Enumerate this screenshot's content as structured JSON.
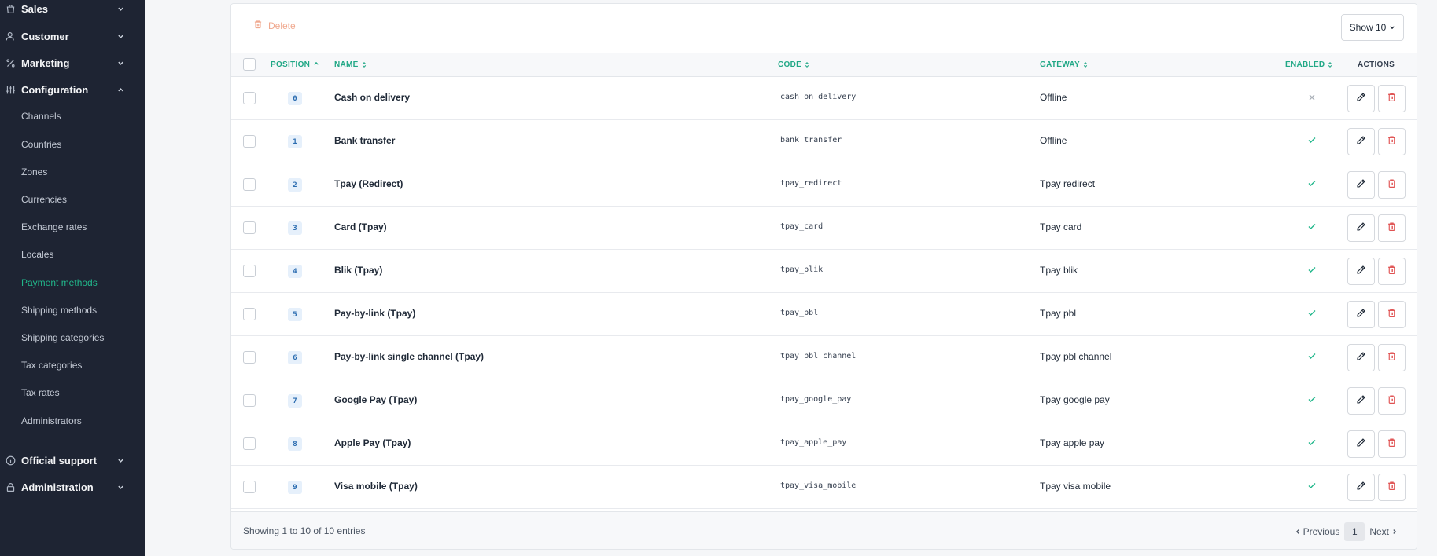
{
  "sidebar": {
    "groups": [
      {
        "label": "Sales",
        "icon": "shopping-bag-icon"
      },
      {
        "label": "Customer",
        "icon": "user-icon"
      },
      {
        "label": "Marketing",
        "icon": "percent-icon"
      },
      {
        "label": "Configuration",
        "icon": "sliders-icon"
      },
      {
        "label": "Official support",
        "icon": "info-icon"
      },
      {
        "label": "Administration",
        "icon": "lock-icon"
      }
    ],
    "config_items": [
      "Channels",
      "Countries",
      "Zones",
      "Currencies",
      "Exchange rates",
      "Locales",
      "Payment methods",
      "Shipping methods",
      "Shipping categories",
      "Tax categories",
      "Tax rates",
      "Administrators"
    ],
    "active_item": "Payment methods"
  },
  "toolbar": {
    "delete_label": "Delete",
    "show_label": "Show 10"
  },
  "table": {
    "headers": {
      "position": "POSITION",
      "name": "NAME",
      "code": "CODE",
      "gateway": "GATEWAY",
      "enabled": "ENABLED",
      "actions": "ACTIONS"
    },
    "rows": [
      {
        "position": "0",
        "name": "Cash on delivery",
        "code": "cash_on_delivery",
        "gateway": "Offline",
        "enabled": false
      },
      {
        "position": "1",
        "name": "Bank transfer",
        "code": "bank_transfer",
        "gateway": "Offline",
        "enabled": true
      },
      {
        "position": "2",
        "name": "Tpay (Redirect)",
        "code": "tpay_redirect",
        "gateway": "Tpay redirect",
        "enabled": true
      },
      {
        "position": "3",
        "name": "Card (Tpay)",
        "code": "tpay_card",
        "gateway": "Tpay card",
        "enabled": true
      },
      {
        "position": "4",
        "name": "Blik (Tpay)",
        "code": "tpay_blik",
        "gateway": "Tpay blik",
        "enabled": true
      },
      {
        "position": "5",
        "name": "Pay-by-link (Tpay)",
        "code": "tpay_pbl",
        "gateway": "Tpay pbl",
        "enabled": true
      },
      {
        "position": "6",
        "name": "Pay-by-link single channel (Tpay)",
        "code": "tpay_pbl_channel",
        "gateway": "Tpay pbl channel",
        "enabled": true
      },
      {
        "position": "7",
        "name": "Google Pay (Tpay)",
        "code": "tpay_google_pay",
        "gateway": "Tpay google pay",
        "enabled": true
      },
      {
        "position": "8",
        "name": "Apple Pay (Tpay)",
        "code": "tpay_apple_pay",
        "gateway": "Tpay apple pay",
        "enabled": true
      },
      {
        "position": "9",
        "name": "Visa mobile (Tpay)",
        "code": "tpay_visa_mobile",
        "gateway": "Tpay visa mobile",
        "enabled": true
      }
    ]
  },
  "footer": {
    "entries_text": "Showing 1 to 10 of 10 entries",
    "previous_label": "Previous",
    "next_label": "Next",
    "current_page": "1"
  },
  "colors": {
    "sidebar_bg": "#1e2433",
    "accent": "#21b78b",
    "danger": "#e05252",
    "delete_muted": "#f0a98f"
  }
}
